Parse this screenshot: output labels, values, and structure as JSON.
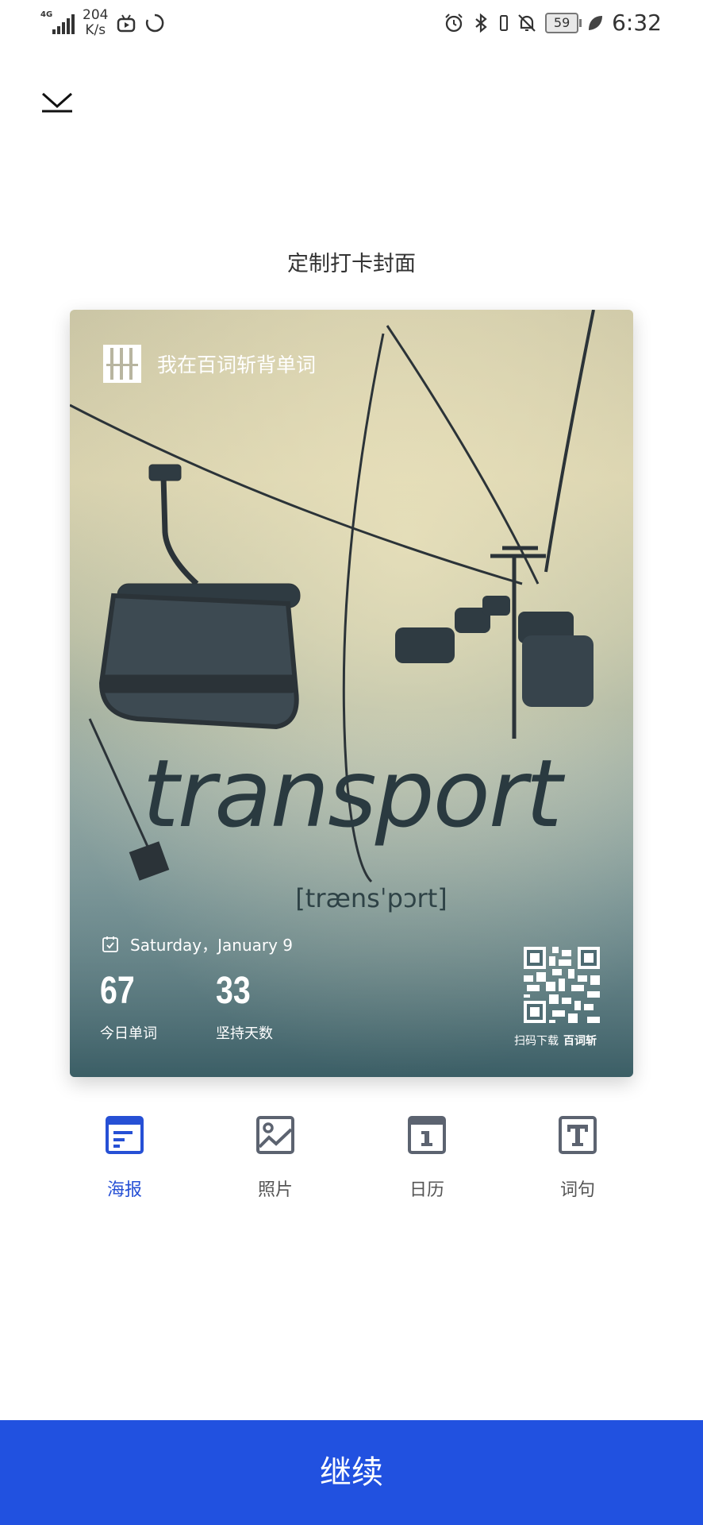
{
  "status_bar": {
    "net_speed_value": "204",
    "net_speed_unit": "K/s",
    "network_type": "4G",
    "battery": "59",
    "time": "6:32"
  },
  "header": {
    "title": "定制打卡封面"
  },
  "poster": {
    "brand_text": "我在百词斩背单词",
    "word": "transport",
    "phonetic": "[trænsˈpɔrt]",
    "date": "Saturday，January 9",
    "stats": [
      {
        "value": "67",
        "label": "今日单词"
      },
      {
        "value": "33",
        "label": "坚持天数"
      }
    ],
    "qr_caption_prefix": "扫码下载",
    "qr_caption_app": "百词斩"
  },
  "tabs": [
    {
      "label": "海报",
      "icon": "poster-icon",
      "active": true
    },
    {
      "label": "照片",
      "icon": "photo-icon",
      "active": false
    },
    {
      "label": "日历",
      "icon": "calendar-icon",
      "active": false
    },
    {
      "label": "词句",
      "icon": "text-icon",
      "active": false
    }
  ],
  "colors": {
    "accent": "#2151e0",
    "tab_active": "#2650d5",
    "tab_inactive": "#5c6370"
  },
  "continue_label": "继续"
}
